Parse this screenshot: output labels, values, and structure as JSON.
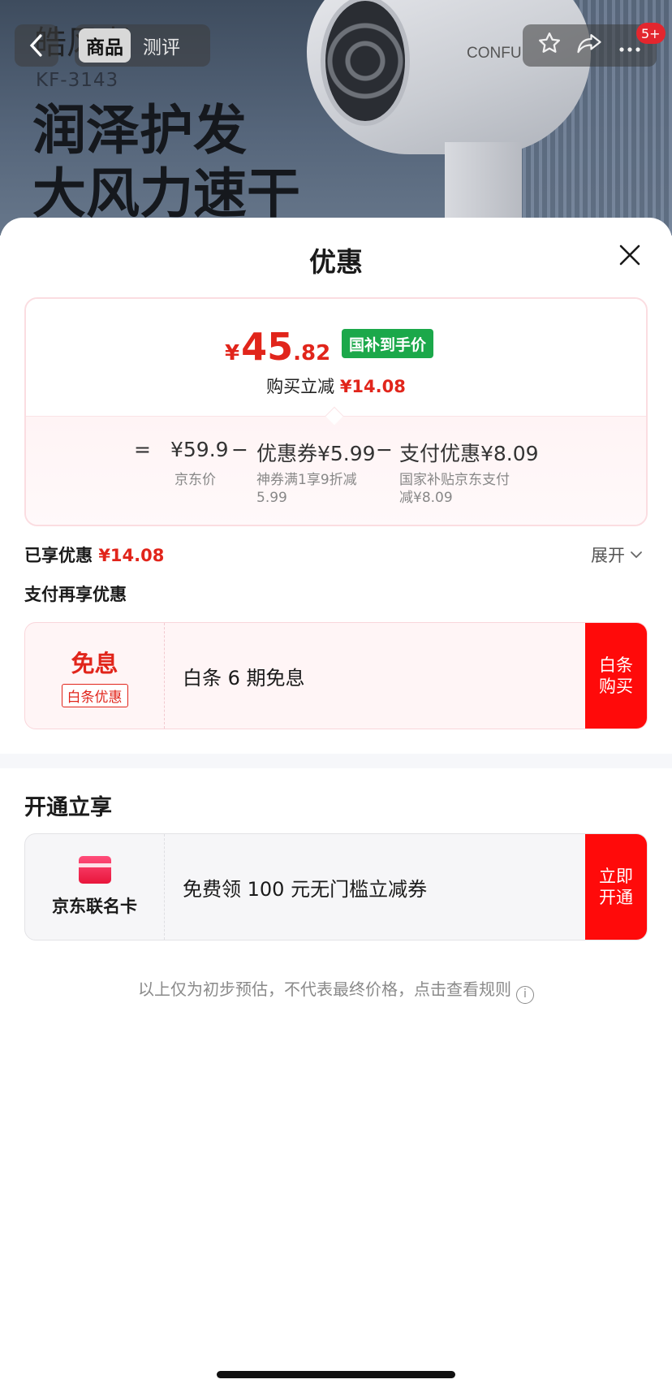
{
  "banner": {
    "product_name": "皓风者",
    "model": "KF-3143",
    "slogan_line1": "润泽护发",
    "slogan_line2": "大风力速干",
    "brand_mark": "CONFU",
    "nav": {
      "back_icon": "chevron-left-icon",
      "tabs": [
        "商品",
        "测评"
      ],
      "active_tab": 0,
      "badge": "5+"
    }
  },
  "sheet": {
    "title": "优惠",
    "price": {
      "yen": "¥",
      "integer": "45",
      "decimal": ".82",
      "tag": "国补到手价",
      "instant_label": "购买立减",
      "instant_value": "¥14.08"
    },
    "breakdown": {
      "equals": "=",
      "base_price": "¥59.9",
      "base_label": "京东价",
      "minus1": "−",
      "coupon": "优惠券¥5.99",
      "coupon_desc_line1": "神券满1享9折减",
      "coupon_desc_line2": "5.99",
      "minus2": "−",
      "pay_discount": "支付优惠¥8.09",
      "pay_desc_line1": "国家补贴京东支付",
      "pay_desc_line2": "减¥8.09"
    },
    "enjoyed_label": "已享优惠",
    "enjoyed_value": "¥14.08",
    "expand_label": "展开",
    "pay_more_label": "支付再享优惠",
    "baitiao_offer": {
      "left_title": "免息",
      "left_tag": "白条优惠",
      "desc": "白条 6 期免息",
      "button": "白条\n购买"
    },
    "open_section_title": "开通立享",
    "card_offer": {
      "card_name": "京东联名卡",
      "desc": "免费领 100 元无门槛立减券",
      "button": "立即\n开通"
    },
    "disclaimer": "以上仅为初步预估，不代表最终价格，点击查看规则"
  },
  "colors": {
    "accent_red": "#e1251b",
    "button_red": "#ff0a0a",
    "subsidy_green": "#1ba84a"
  }
}
